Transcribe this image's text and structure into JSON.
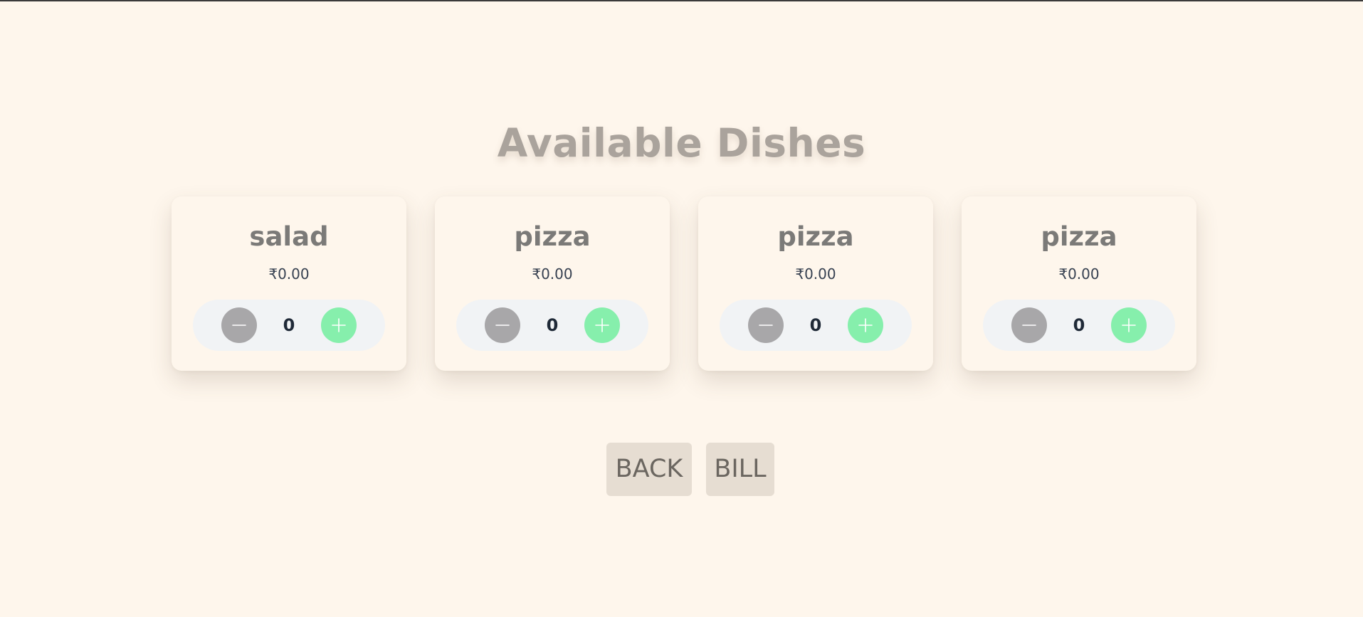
{
  "page": {
    "title": "Available Dishes"
  },
  "dishes": [
    {
      "name": "salad",
      "price": "₹0.00",
      "quantity": "0"
    },
    {
      "name": "pizza",
      "price": "₹0.00",
      "quantity": "0"
    },
    {
      "name": "pizza",
      "price": "₹0.00",
      "quantity": "0"
    },
    {
      "name": "pizza",
      "price": "₹0.00",
      "quantity": "0"
    }
  ],
  "icons": {
    "decrement": "minus-icon",
    "increment": "plus-icon"
  },
  "actions": {
    "back_label": "BACK",
    "bill_label": "BILL"
  },
  "colors": {
    "background": "#fef6ec",
    "decrement_button": "#a8a7a9",
    "increment_button": "#86efac",
    "action_button": "#e6ddd2"
  }
}
